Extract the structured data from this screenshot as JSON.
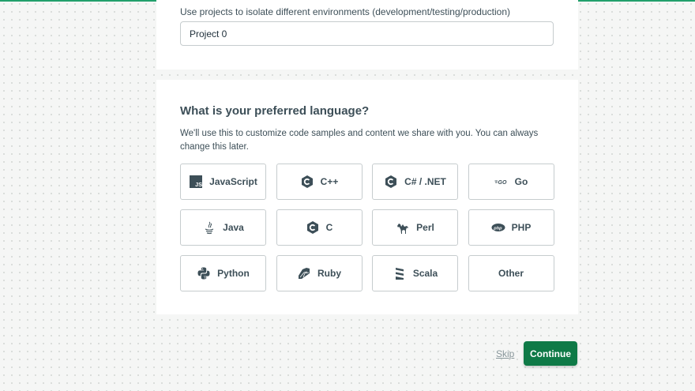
{
  "project": {
    "hint": "Use projects to isolate different environments (development/testing/production)",
    "name_value": "Project 0"
  },
  "language": {
    "title": "What is your preferred language?",
    "description": "We'll use this to customize code samples and content we share with you. You can always change this later.",
    "options": [
      {
        "label": "JavaScript",
        "icon": "javascript-icon"
      },
      {
        "label": "C++",
        "icon": "cpp-icon"
      },
      {
        "label": "C# / .NET",
        "icon": "csharp-icon"
      },
      {
        "label": "Go",
        "icon": "go-icon"
      },
      {
        "label": "Java",
        "icon": "java-icon"
      },
      {
        "label": "C",
        "icon": "c-icon"
      },
      {
        "label": "Perl",
        "icon": "perl-icon"
      },
      {
        "label": "PHP",
        "icon": "php-icon"
      },
      {
        "label": "Python",
        "icon": "python-icon"
      },
      {
        "label": "Ruby",
        "icon": "ruby-icon"
      },
      {
        "label": "Scala",
        "icon": "scala-icon"
      },
      {
        "label": "Other",
        "icon": ""
      }
    ]
  },
  "footer": {
    "skip_label": "Skip",
    "continue_label": "Continue"
  },
  "colors": {
    "accent": "#21a06b",
    "primary_button": "#0f7a47",
    "text": "#3d4f58",
    "border": "#c6ccce"
  }
}
